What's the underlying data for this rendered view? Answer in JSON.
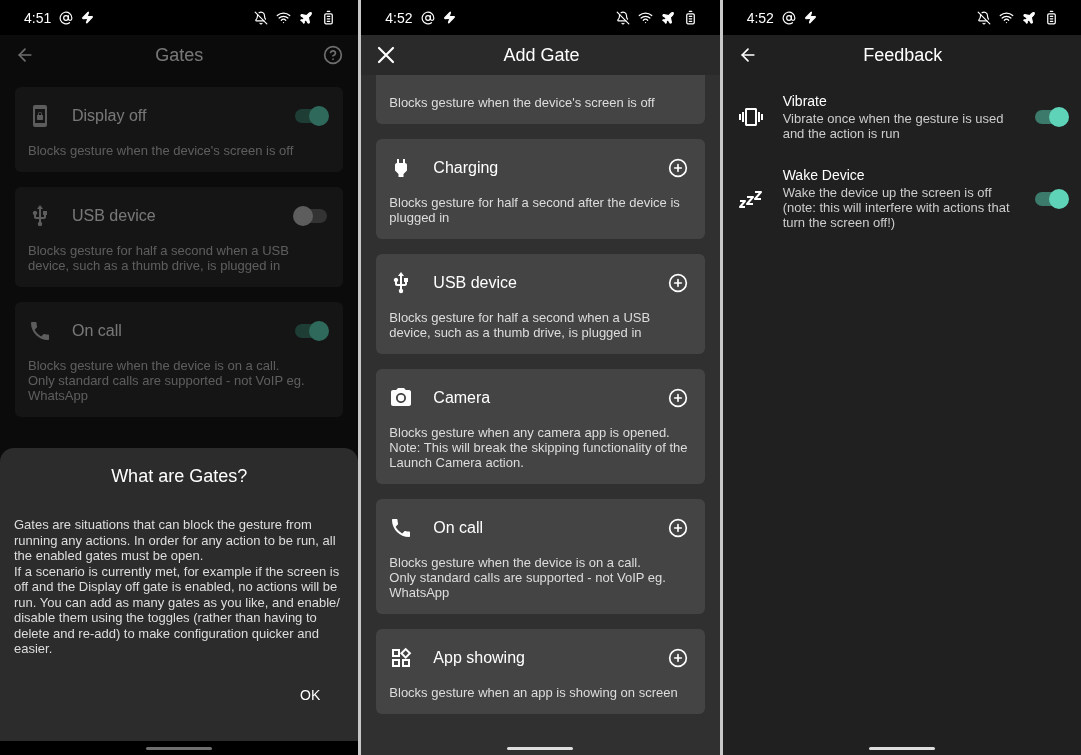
{
  "screens": [
    {
      "kind": "gates",
      "time": "4:51",
      "title": "Gates",
      "gates": [
        {
          "kind": "display",
          "title": "Display off",
          "description": "Blocks gesture when the device's screen is off",
          "on": true
        },
        {
          "kind": "usb",
          "title": "USB device",
          "description": "Blocks gesture for half a second when a USB device, such as a thumb drive, is plugged in",
          "on": false
        },
        {
          "kind": "call",
          "title": "On call",
          "description": "Blocks gesture when the device is on a call.\nOnly standard calls are supported - not VoIP eg. WhatsApp",
          "on": true
        }
      ],
      "dialog": {
        "title": "What are Gates?",
        "body": "Gates are situations that can block the gesture from running any actions. In order for any action to be run, all the enabled gates must be open.\nIf a scenario is currently met, for example if the screen is off and the Display off gate is enabled, no actions will be run. You can add as many gates as you like, and enable/ disable them using the toggles (rather than having to delete and re-add) to make configuration quicker and easier.",
        "button": "OK"
      }
    },
    {
      "kind": "add_gate",
      "time": "4:52",
      "title": "Add Gate",
      "gates": [
        {
          "description": "Blocks gesture when the device's screen is off"
        },
        {
          "kind": "charging",
          "title": "Charging",
          "description": "Blocks gesture for half a second after the device is plugged in"
        },
        {
          "kind": "usb",
          "title": "USB device",
          "description": "Blocks gesture for half a second when a USB device, such as a thumb drive, is plugged in"
        },
        {
          "kind": "camera",
          "title": "Camera",
          "description": "Blocks gesture when any camera app is opened. Note: This will break the skipping functionality of the Launch Camera action."
        },
        {
          "kind": "call",
          "title": "On call",
          "description": "Blocks gesture when the device is on a call.\nOnly standard calls are supported - not VoIP eg. WhatsApp"
        },
        {
          "kind": "app",
          "title": "App showing",
          "description": "Blocks gesture when an app is showing on screen"
        }
      ]
    },
    {
      "kind": "feedback",
      "time": "4:52",
      "title": "Feedback",
      "settings": [
        {
          "kind": "vibrate",
          "title": "Vibrate",
          "description": "Vibrate once when the gesture is used and the action is run",
          "on": true
        },
        {
          "kind": "wake",
          "title": "Wake Device",
          "description": "Wake the device up the screen is off (note: this will interfere with actions that turn the screen off!)",
          "on": true
        }
      ]
    }
  ]
}
